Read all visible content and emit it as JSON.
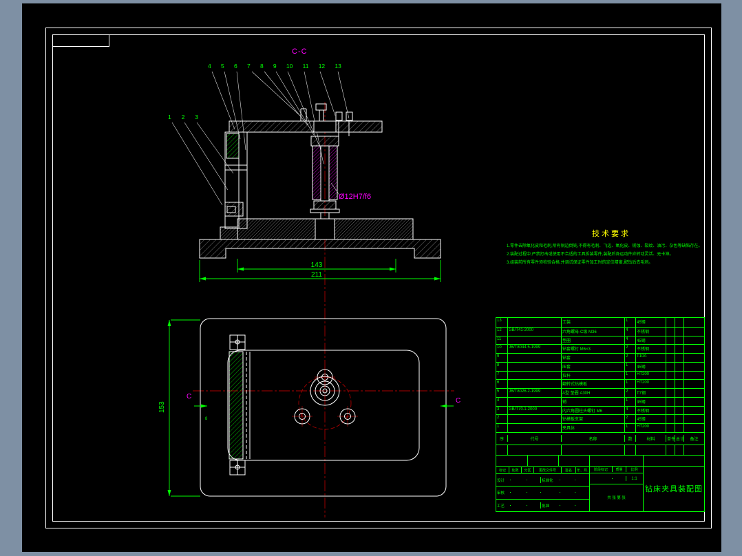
{
  "colors": {
    "background": "#7e90a4",
    "canvas": "#000000",
    "line": "#ffffff",
    "dimension": "#00ff00",
    "label": "#ff00ff",
    "centerline": "#aa0000",
    "req_title": "#ffff00"
  },
  "section_view": {
    "label": "C-C",
    "callouts_top": [
      "4",
      "5",
      "6",
      "7",
      "8",
      "9",
      "10",
      "11",
      "12",
      "13"
    ],
    "callouts_left": [
      "1",
      "2",
      "3"
    ],
    "fit_label": "Ø12H7/f6",
    "dim_inner": "143",
    "dim_outer": "211"
  },
  "plan_view": {
    "height_dim": "153",
    "section_marks": [
      "C",
      "C"
    ],
    "small_dim": "8"
  },
  "tech_requirements": {
    "title": "技术要求",
    "items": [
      "1.零件去除氧化皮和毛刺,所有锐边倒钝,不得有毛刺、飞边、氧化皮、锈蚀、裂纹、油污、杂色等缺陷存在。",
      "2.装配过程中,严禁打击或使用不合适的工具拆装零件,装配后各运动件应转动灵活、无卡滞。",
      "3.组装前所有零件须检验合格,并调试保证零件加工时的定位精度,配钻后去毛刺。"
    ]
  },
  "bom": {
    "headers": [
      "序",
      "代号",
      "名称",
      "数",
      "材料",
      "单件",
      "总计",
      "备注"
    ],
    "rows": [
      {
        "no": "13",
        "code": "",
        "name": "工装",
        "qty": "1",
        "material": "45钢",
        "w1": "",
        "w2": "",
        "note": ""
      },
      {
        "no": "12",
        "code": "GB/T41-2000",
        "name": "六角螺母-C级 M36",
        "qty": "4",
        "material": "不锈钢",
        "w1": "",
        "w2": "",
        "note": ""
      },
      {
        "no": "11",
        "code": "",
        "name": "垫圈",
        "qty": "4",
        "material": "45钢",
        "w1": "",
        "w2": "",
        "note": ""
      },
      {
        "no": "10",
        "code": "JB/T8044.5-1999",
        "name": "钻套螺钉 M6×3",
        "qty": "2",
        "material": "不锈钢",
        "w1": "",
        "w2": "",
        "note": ""
      },
      {
        "no": "9",
        "code": "",
        "name": "钻套",
        "qty": "2",
        "material": "T10A",
        "w1": "",
        "w2": "",
        "note": ""
      },
      {
        "no": "8",
        "code": "",
        "name": "压套",
        "qty": "1",
        "material": "45钢",
        "w1": "",
        "w2": "",
        "note": ""
      },
      {
        "no": "7",
        "code": "",
        "name": "拉杆",
        "qty": "1",
        "material": "HT200",
        "w1": "",
        "w2": "",
        "note": ""
      },
      {
        "no": "6",
        "code": "",
        "name": "翻转式钻模板",
        "qty": "1",
        "material": "HT200",
        "w1": "",
        "w2": "",
        "note": ""
      },
      {
        "no": "5",
        "code": "JB/T8026.2-1999",
        "name": "A型 垫圈 A30H",
        "qty": "2",
        "material": "T7钢",
        "w1": "",
        "w2": "",
        "note": ""
      },
      {
        "no": "4",
        "code": "",
        "name": "销",
        "qty": "1",
        "material": "35钢",
        "w1": "",
        "w2": "",
        "note": ""
      },
      {
        "no": "3",
        "code": "GB/T70.1-2000",
        "name": "内六角圆柱头螺钉 M6",
        "qty": "4",
        "material": "不锈钢",
        "w1": "",
        "w2": "",
        "note": ""
      },
      {
        "no": "2",
        "code": "",
        "name": "钻模板支架",
        "qty": "2",
        "material": "45钢",
        "w1": "",
        "w2": "",
        "note": ""
      },
      {
        "no": "1",
        "code": "",
        "name": "夹具体",
        "qty": "1",
        "material": "HT200",
        "w1": "",
        "w2": "",
        "note": ""
      }
    ]
  },
  "titleblock": {
    "rev_row": [
      "标记",
      "处数",
      "分区",
      "更改文件号",
      "签名",
      "年、月、日"
    ],
    "sign_rows": [
      [
        "设计",
        "",
        "",
        "标准化",
        "",
        ""
      ],
      [
        "审核",
        "",
        "",
        "",
        "",
        ""
      ],
      [
        "工艺",
        "",
        "",
        "批准",
        "",
        ""
      ]
    ],
    "stage_label": "阶段标记",
    "mass_label": "质量",
    "scale_label": "比例",
    "scale_value": "1:1",
    "sheet_label": "共 张 第 张",
    "drawing_title": "钻床夹具装配图"
  }
}
